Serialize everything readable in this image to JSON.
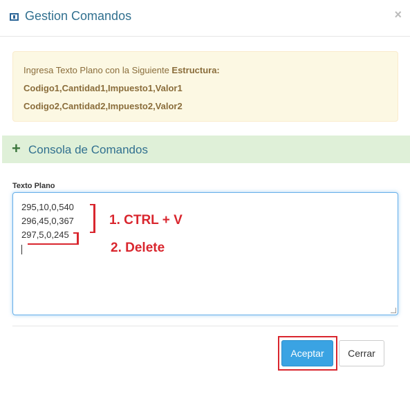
{
  "header": {
    "title": "Gestion Comandos",
    "close_label": "×",
    "icon": "window-icon"
  },
  "alert": {
    "intro": "Ingresa Texto Plano con la Siguiente ",
    "intro_bold": "Estructura:",
    "line2": "Codigo1,Cantidad1,Impuesto1,Valor1",
    "line3": "Codigo2,Cantidad2,Impuesto2,Valor2"
  },
  "console": {
    "title": "Consola de Comandos",
    "icon": "plus-icon"
  },
  "form": {
    "label": "Texto Plano",
    "lines": [
      "295,10,0,540",
      "296,45,0,367",
      "297,5,0,245"
    ]
  },
  "annotations": {
    "step1": "1. CTRL + V",
    "step2": "2. Delete"
  },
  "footer": {
    "accept_label": "Aceptar",
    "close_label": "Cerrar"
  },
  "colors": {
    "title": "#31708f",
    "alert_bg": "#fcf8e3",
    "console_bg": "#dff0d8",
    "primary": "#3aa3e3",
    "annotation": "#d9262e"
  }
}
